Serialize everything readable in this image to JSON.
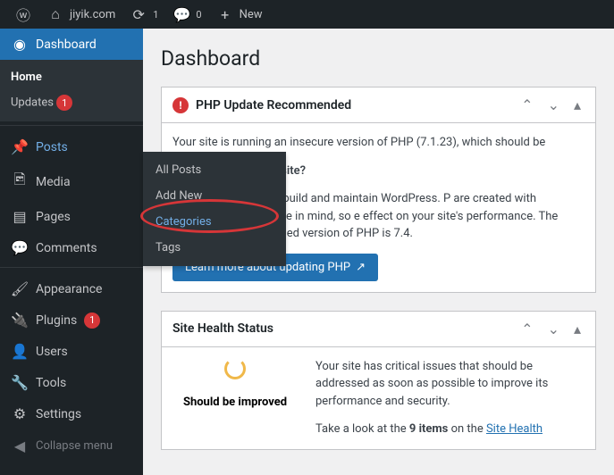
{
  "toolbar": {
    "site": "jiyik.com",
    "refresh": "1",
    "comments": "0",
    "new": "New"
  },
  "sidebar": {
    "dashboard": "Dashboard",
    "home": "Home",
    "updates": "Updates",
    "updates_count": "1",
    "posts": "Posts",
    "media": "Media",
    "pages": "Pages",
    "comments": "Comments",
    "appearance": "Appearance",
    "plugins": "Plugins",
    "plugins_count": "1",
    "users": "Users",
    "tools": "Tools",
    "settings": "Settings",
    "collapse": "Collapse menu"
  },
  "submenu": {
    "all_posts": "All Posts",
    "add_new": "Add New",
    "categories": "Categories",
    "tags": "Tags"
  },
  "page": {
    "title": "Dashboard"
  },
  "php_panel": {
    "title": "PHP Update Recommended",
    "intro": "Your site is running an insecure version of PHP (7.1.23), which should be",
    "q": "ow does it affect my site?",
    "body": "ing language used to build and maintain WordPress. P are created with increased performance in mind, so e effect on your site's performance. The minimum recommended version of PHP is 7.4.",
    "button": "Learn more about updating PHP"
  },
  "health_panel": {
    "title": "Site Health Status",
    "status": "Should be improved",
    "text1": "Your site has critical issues that should be addressed as soon as possible to improve its performance and security.",
    "text2_a": "Take a look at the ",
    "text2_b": "9 items",
    "text2_c": " on the ",
    "link": "Site Health"
  }
}
